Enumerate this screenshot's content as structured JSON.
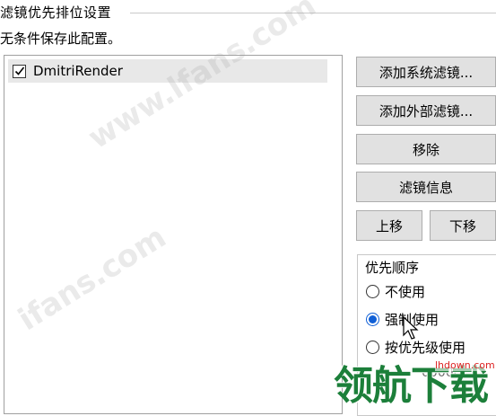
{
  "header": {
    "title": "滤镜优先排位设置",
    "subtitle": "无条件保存此配置。"
  },
  "filter_list": {
    "items": [
      {
        "label": "DmitriRender",
        "checked": true
      }
    ]
  },
  "buttons": {
    "add_system": "添加系统滤镜...",
    "add_external": "添加外部滤镜...",
    "remove": "移除",
    "filter_info": "滤镜信息",
    "move_up": "上移",
    "move_down": "下移"
  },
  "priority": {
    "title": "优先顺序",
    "options": [
      {
        "label": "不使用",
        "selected": false
      },
      {
        "label": "强制使用",
        "selected": true
      },
      {
        "label": "按优先级使用",
        "selected": false
      }
    ],
    "partial_value": "00000"
  },
  "watermark": {
    "text_1": "www.lfans.com",
    "text_2": "ifans.com",
    "logo": "领航下载",
    "logo_url": "lhdown.com"
  },
  "colors": {
    "accent": "#0f5fd6",
    "button_bg": "#e1e1e1",
    "logo_green": "#1c7f3a"
  }
}
